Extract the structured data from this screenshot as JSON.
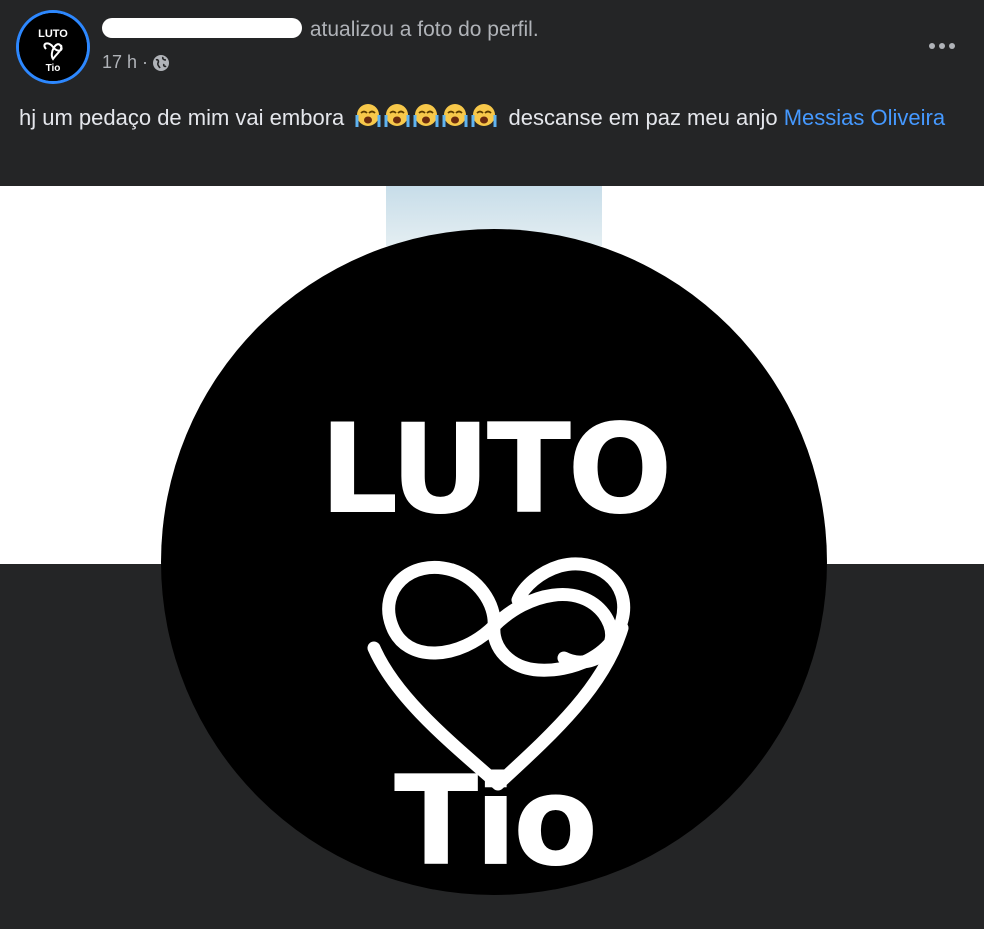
{
  "post": {
    "author_action": "atualizou a foto do perfil.",
    "timestamp": "17 h ·",
    "privacy_icon": "globe-icon",
    "more_icon": "more-horizontal-icon",
    "text_before": "hj um pedaço de mim vai embora",
    "emoji_name": "loudly-crying-face",
    "emoji_count": 5,
    "text_after": "descanse em paz meu anjo",
    "mention": "Messias Oliveira"
  },
  "profile_photo": {
    "line1": "LUTO",
    "line3": "Tio",
    "symbol_icon": "infinity-heart-icon"
  },
  "avatar": {
    "line1": "LUTO",
    "line3": "Tio"
  },
  "colors": {
    "background": "#242526",
    "text": "#e4e6eb",
    "secondary_text": "#b0b3b8",
    "link": "#4599ff",
    "avatar_ring": "#2d88ff"
  }
}
